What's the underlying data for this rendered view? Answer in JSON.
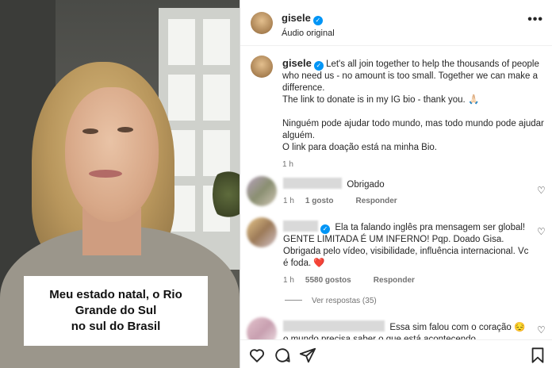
{
  "video": {
    "caption": "Meu estado natal, o Rio\nGrande do Sul\nno sul do Brasil"
  },
  "header": {
    "username": "gisele",
    "audio": "Áudio original",
    "more_icon": "more-horizontal-icon"
  },
  "post": {
    "username": "gisele",
    "para1": "Let's all join together to help the thousands of people who need us - no amount is too small. Together we can make a difference.",
    "para1b": "The link to donate is in my IG bio - thank you. 🙏🏻",
    "para2": "Ninguém pode ajudar todo mundo, mas todo mundo pode ajudar alguém.",
    "para2b": "O link para doação está na minha Bio.",
    "time": "1 h"
  },
  "comments": [
    {
      "text": "Obrigado",
      "time": "1 h",
      "likes": "1 gosto",
      "reply": "Responder"
    },
    {
      "text": "Ela ta falando inglês pra mensagem ser global! GENTE LIMITADA É UM INFERNO! Pqp. Doado Gisa. Obrigada pelo vídeo, visibilidade, influência internacional. Vc é foda. ❤️",
      "time": "1 h",
      "likes": "5580 gostos",
      "reply": "Responder",
      "view_replies": "Ver respostas (35)"
    },
    {
      "text": "Essa sim falou com o coração 😔 o mundo precisa saber o que está acontecendo"
    }
  ],
  "colors": {
    "verified": "#0095f6",
    "muted": "#737373"
  }
}
